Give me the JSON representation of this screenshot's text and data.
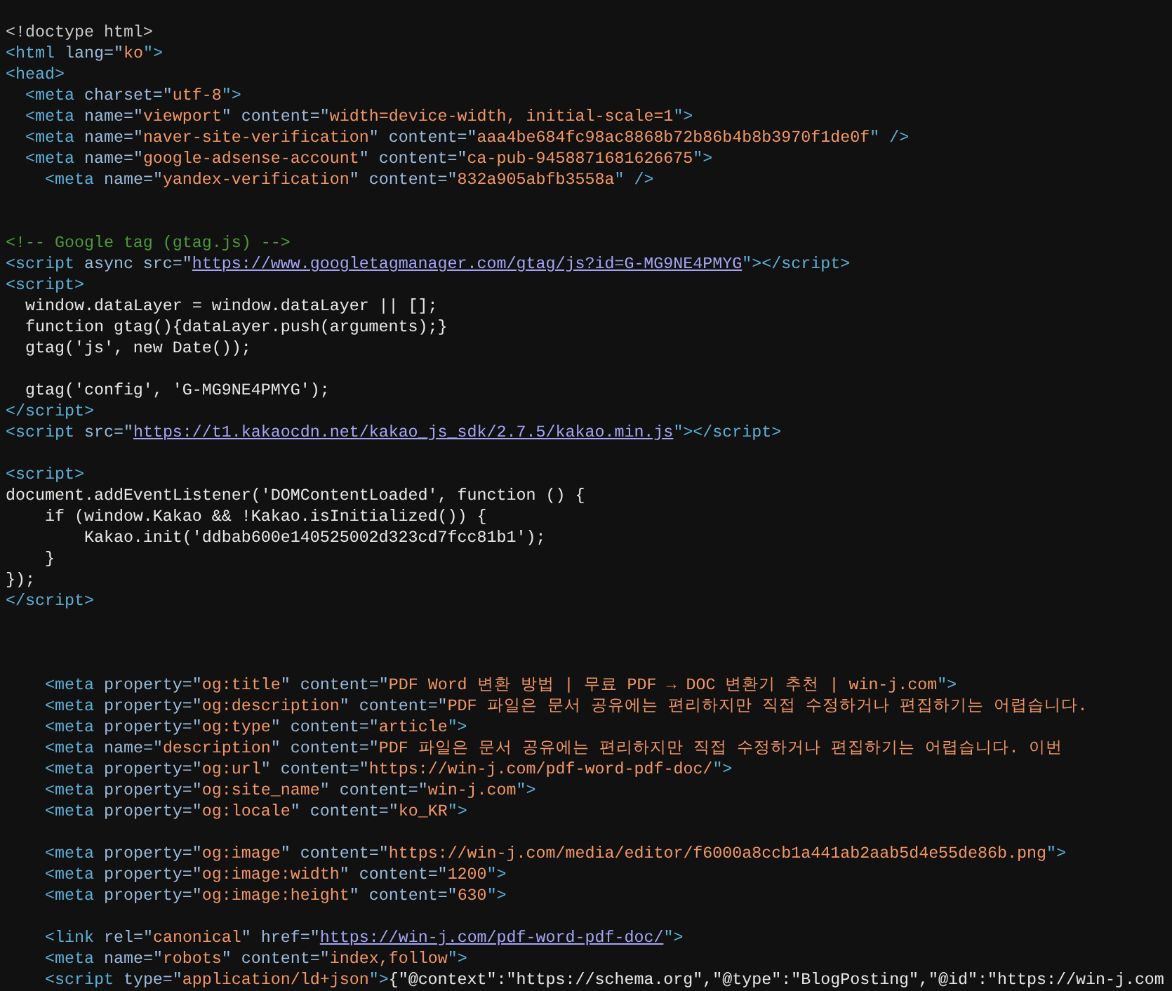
{
  "source_lines": [
    {
      "kind": "code",
      "tokens": [
        {
          "kind": "doctype",
          "text": "<!doctype html>"
        }
      ]
    },
    {
      "kind": "code",
      "tokens": [
        {
          "kind": "tag",
          "text": "<html"
        },
        {
          "kind": "attr",
          "text": " lang=\""
        },
        {
          "kind": "value",
          "text": "ko"
        },
        {
          "kind": "tag",
          "text": "\">"
        }
      ]
    },
    {
      "kind": "code",
      "tokens": [
        {
          "kind": "tag",
          "text": "<head>"
        }
      ]
    },
    {
      "kind": "code",
      "tokens": [
        {
          "kind": "tag",
          "text": "  <meta"
        },
        {
          "kind": "attr",
          "text": " charset=\""
        },
        {
          "kind": "value",
          "text": "utf-8"
        },
        {
          "kind": "tag",
          "text": "\">"
        }
      ]
    },
    {
      "kind": "code",
      "tokens": [
        {
          "kind": "tag",
          "text": "  <meta"
        },
        {
          "kind": "attr",
          "text": " name=\""
        },
        {
          "kind": "value",
          "text": "viewport"
        },
        {
          "kind": "attr",
          "text": "\" content=\""
        },
        {
          "kind": "value",
          "text": "width=device-width, initial-scale=1"
        },
        {
          "kind": "tag",
          "text": "\">"
        }
      ]
    },
    {
      "kind": "code",
      "tokens": [
        {
          "kind": "tag",
          "text": "  <meta"
        },
        {
          "kind": "attr",
          "text": " name=\""
        },
        {
          "kind": "value",
          "text": "naver-site-verification"
        },
        {
          "kind": "attr",
          "text": "\" content=\""
        },
        {
          "kind": "value",
          "text": "aaa4be684fc98ac8868b72b86b4b8b3970f1de0f"
        },
        {
          "kind": "tag",
          "text": "\" />"
        }
      ]
    },
    {
      "kind": "code",
      "tokens": [
        {
          "kind": "tag",
          "text": "  <meta"
        },
        {
          "kind": "attr",
          "text": " name=\""
        },
        {
          "kind": "value",
          "text": "google-adsense-account"
        },
        {
          "kind": "attr",
          "text": "\" content=\""
        },
        {
          "kind": "value",
          "text": "ca-pub-9458871681626675"
        },
        {
          "kind": "tag",
          "text": "\">"
        }
      ]
    },
    {
      "kind": "code",
      "tokens": [
        {
          "kind": "tag",
          "text": "    <meta"
        },
        {
          "kind": "attr",
          "text": " name=\""
        },
        {
          "kind": "value",
          "text": "yandex-verification"
        },
        {
          "kind": "attr",
          "text": "\" content=\""
        },
        {
          "kind": "value",
          "text": "832a905abfb3558a"
        },
        {
          "kind": "tag",
          "text": "\" />"
        }
      ]
    },
    {
      "kind": "blank"
    },
    {
      "kind": "blank"
    },
    {
      "kind": "code",
      "tokens": [
        {
          "kind": "comment",
          "text": "<!-- Google tag (gtag.js) -->"
        }
      ]
    },
    {
      "kind": "code",
      "tokens": [
        {
          "kind": "tag",
          "text": "<script"
        },
        {
          "kind": "attr",
          "text": " async src=\""
        },
        {
          "kind": "link",
          "text": "https://www.googletagmanager.com/gtag/js?id=G-MG9NE4PMYG"
        },
        {
          "kind": "tag",
          "text": "\"></script>"
        }
      ]
    },
    {
      "kind": "code",
      "tokens": [
        {
          "kind": "tag",
          "text": "<script>"
        }
      ]
    },
    {
      "kind": "code",
      "tokens": [
        {
          "kind": "text",
          "text": "  window.dataLayer = window.dataLayer || [];"
        }
      ]
    },
    {
      "kind": "code",
      "tokens": [
        {
          "kind": "text",
          "text": "  function gtag(){dataLayer.push(arguments);}"
        }
      ]
    },
    {
      "kind": "code",
      "tokens": [
        {
          "kind": "text",
          "text": "  gtag('js', new Date());"
        }
      ]
    },
    {
      "kind": "blank"
    },
    {
      "kind": "code",
      "tokens": [
        {
          "kind": "text",
          "text": "  gtag('config', 'G-MG9NE4PMYG');"
        }
      ]
    },
    {
      "kind": "code",
      "tokens": [
        {
          "kind": "tag",
          "text": "</script>"
        }
      ]
    },
    {
      "kind": "code",
      "tokens": [
        {
          "kind": "tag",
          "text": "<script"
        },
        {
          "kind": "attr",
          "text": " src=\""
        },
        {
          "kind": "link",
          "text": "https://t1.kakaocdn.net/kakao_js_sdk/2.7.5/kakao.min.js"
        },
        {
          "kind": "tag",
          "text": "\"></script>"
        }
      ]
    },
    {
      "kind": "blank"
    },
    {
      "kind": "code",
      "tokens": [
        {
          "kind": "tag",
          "text": "<script>"
        }
      ]
    },
    {
      "kind": "code",
      "tokens": [
        {
          "kind": "text",
          "text": "document.addEventListener('DOMContentLoaded', function () {"
        }
      ]
    },
    {
      "kind": "code",
      "tokens": [
        {
          "kind": "text",
          "text": "    if (window.Kakao && !Kakao.isInitialized()) {"
        }
      ]
    },
    {
      "kind": "code",
      "tokens": [
        {
          "kind": "text",
          "text": "        Kakao.init('ddbab600e140525002d323cd7fcc81b1');"
        }
      ]
    },
    {
      "kind": "code",
      "tokens": [
        {
          "kind": "text",
          "text": "    }"
        }
      ]
    },
    {
      "kind": "code",
      "tokens": [
        {
          "kind": "text",
          "text": "});"
        }
      ]
    },
    {
      "kind": "code",
      "tokens": [
        {
          "kind": "tag",
          "text": "</script>"
        }
      ]
    },
    {
      "kind": "blank"
    },
    {
      "kind": "blank"
    },
    {
      "kind": "blank"
    },
    {
      "kind": "code",
      "tokens": [
        {
          "kind": "tag",
          "text": "    <meta"
        },
        {
          "kind": "attr",
          "text": " property=\""
        },
        {
          "kind": "value",
          "text": "og:title"
        },
        {
          "kind": "attr",
          "text": "\" content=\""
        },
        {
          "kind": "value",
          "text": "PDF Word 변환 방법 | 무료 PDF → DOC 변환기 추천 | win-j.com"
        },
        {
          "kind": "tag",
          "text": "\">"
        }
      ]
    },
    {
      "kind": "code",
      "tokens": [
        {
          "kind": "tag",
          "text": "    <meta"
        },
        {
          "kind": "attr",
          "text": " property=\""
        },
        {
          "kind": "value",
          "text": "og:description"
        },
        {
          "kind": "attr",
          "text": "\" content=\""
        },
        {
          "kind": "value",
          "text": "PDF 파일은 문서 공유에는 편리하지만 직접 수정하거나 편집하기는 어렵습니다."
        }
      ]
    },
    {
      "kind": "code",
      "tokens": [
        {
          "kind": "tag",
          "text": "    <meta"
        },
        {
          "kind": "attr",
          "text": " property=\""
        },
        {
          "kind": "value",
          "text": "og:type"
        },
        {
          "kind": "attr",
          "text": "\" content=\""
        },
        {
          "kind": "value",
          "text": "article"
        },
        {
          "kind": "tag",
          "text": "\">"
        }
      ]
    },
    {
      "kind": "code",
      "tokens": [
        {
          "kind": "tag",
          "text": "    <meta"
        },
        {
          "kind": "attr",
          "text": " name=\""
        },
        {
          "kind": "value",
          "text": "description"
        },
        {
          "kind": "attr",
          "text": "\" content=\""
        },
        {
          "kind": "value",
          "text": "PDF 파일은 문서 공유에는 편리하지만 직접 수정하거나 편집하기는 어렵습니다. 이번"
        }
      ]
    },
    {
      "kind": "code",
      "tokens": [
        {
          "kind": "tag",
          "text": "    <meta"
        },
        {
          "kind": "attr",
          "text": " property=\""
        },
        {
          "kind": "value",
          "text": "og:url"
        },
        {
          "kind": "attr",
          "text": "\" content=\""
        },
        {
          "kind": "value",
          "text": "https://win-j.com/pdf-word-pdf-doc/"
        },
        {
          "kind": "tag",
          "text": "\">"
        }
      ]
    },
    {
      "kind": "code",
      "tokens": [
        {
          "kind": "tag",
          "text": "    <meta"
        },
        {
          "kind": "attr",
          "text": " property=\""
        },
        {
          "kind": "value",
          "text": "og:site_name"
        },
        {
          "kind": "attr",
          "text": "\" content=\""
        },
        {
          "kind": "value",
          "text": "win-j.com"
        },
        {
          "kind": "tag",
          "text": "\">"
        }
      ]
    },
    {
      "kind": "code",
      "tokens": [
        {
          "kind": "tag",
          "text": "    <meta"
        },
        {
          "kind": "attr",
          "text": " property=\""
        },
        {
          "kind": "value",
          "text": "og:locale"
        },
        {
          "kind": "attr",
          "text": "\" content=\""
        },
        {
          "kind": "value",
          "text": "ko_KR"
        },
        {
          "kind": "tag",
          "text": "\">"
        }
      ]
    },
    {
      "kind": "blank"
    },
    {
      "kind": "code",
      "tokens": [
        {
          "kind": "tag",
          "text": "    <meta"
        },
        {
          "kind": "attr",
          "text": " property=\""
        },
        {
          "kind": "value",
          "text": "og:image"
        },
        {
          "kind": "attr",
          "text": "\" content=\""
        },
        {
          "kind": "value",
          "text": "https://win-j.com/media/editor/f6000a8ccb1a441ab2aab5d4e55de86b.png"
        },
        {
          "kind": "tag",
          "text": "\">"
        }
      ]
    },
    {
      "kind": "code",
      "tokens": [
        {
          "kind": "tag",
          "text": "    <meta"
        },
        {
          "kind": "attr",
          "text": " property=\""
        },
        {
          "kind": "value",
          "text": "og:image:width"
        },
        {
          "kind": "attr",
          "text": "\" content=\""
        },
        {
          "kind": "value",
          "text": "1200"
        },
        {
          "kind": "tag",
          "text": "\">"
        }
      ]
    },
    {
      "kind": "code",
      "tokens": [
        {
          "kind": "tag",
          "text": "    <meta"
        },
        {
          "kind": "attr",
          "text": " property=\""
        },
        {
          "kind": "value",
          "text": "og:image:height"
        },
        {
          "kind": "attr",
          "text": "\" content=\""
        },
        {
          "kind": "value",
          "text": "630"
        },
        {
          "kind": "tag",
          "text": "\">"
        }
      ]
    },
    {
      "kind": "blank"
    },
    {
      "kind": "code",
      "tokens": [
        {
          "kind": "tag",
          "text": "    <link"
        },
        {
          "kind": "attr",
          "text": " rel=\""
        },
        {
          "kind": "value",
          "text": "canonical"
        },
        {
          "kind": "attr",
          "text": "\" href=\""
        },
        {
          "kind": "link",
          "text": "https://win-j.com/pdf-word-pdf-doc/"
        },
        {
          "kind": "tag",
          "text": "\">"
        }
      ]
    },
    {
      "kind": "code",
      "tokens": [
        {
          "kind": "tag",
          "text": "    <meta"
        },
        {
          "kind": "attr",
          "text": " name=\""
        },
        {
          "kind": "value",
          "text": "robots"
        },
        {
          "kind": "attr",
          "text": "\" content=\""
        },
        {
          "kind": "value",
          "text": "index,follow"
        },
        {
          "kind": "tag",
          "text": "\">"
        }
      ]
    },
    {
      "kind": "code",
      "tokens": [
        {
          "kind": "tag",
          "text": "    <script"
        },
        {
          "kind": "attr",
          "text": " type=\""
        },
        {
          "kind": "value",
          "text": "application/ld+json"
        },
        {
          "kind": "tag",
          "text": "\">"
        },
        {
          "kind": "text",
          "text": "{\"@context\":\"https://schema.org\",\"@type\":\"BlogPosting\",\"@id\":\"https://win-j.com"
        }
      ]
    }
  ]
}
